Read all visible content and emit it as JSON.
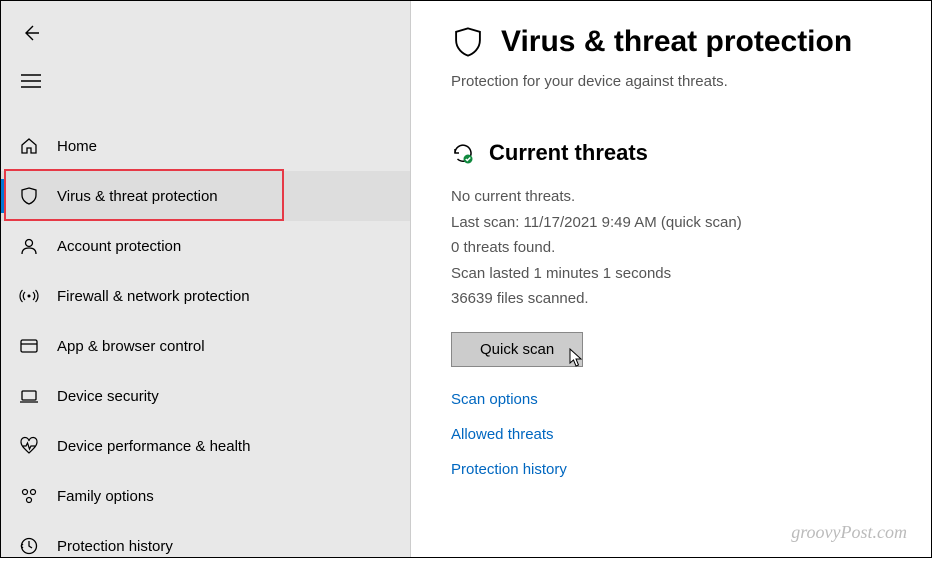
{
  "sidebar": {
    "items": [
      {
        "label": "Home"
      },
      {
        "label": "Virus & threat protection"
      },
      {
        "label": "Account protection"
      },
      {
        "label": "Firewall & network protection"
      },
      {
        "label": "App & browser control"
      },
      {
        "label": "Device security"
      },
      {
        "label": "Device performance & health"
      },
      {
        "label": "Family options"
      },
      {
        "label": "Protection history"
      }
    ]
  },
  "main": {
    "title": "Virus & threat protection",
    "subtitle": "Protection for your device against threats.",
    "section_title": "Current threats",
    "status": {
      "no_threats": "No current threats.",
      "last_scan": "Last scan: 11/17/2021 9:49 AM (quick scan)",
      "threats_found": "0 threats found.",
      "duration": "Scan lasted 1 minutes 1 seconds",
      "files_scanned": "36639 files scanned."
    },
    "quick_scan_label": "Quick scan",
    "links": {
      "scan_options": "Scan options",
      "allowed_threats": "Allowed threats",
      "protection_history": "Protection history"
    }
  },
  "watermark": "groovyPost.com"
}
